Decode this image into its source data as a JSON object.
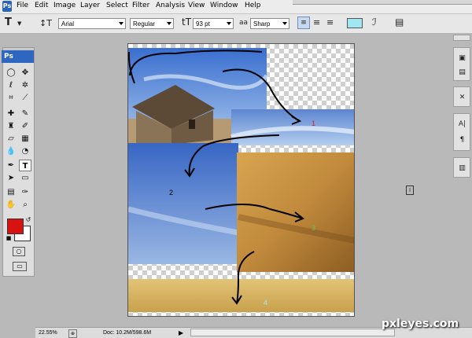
{
  "menubar": {
    "items": [
      "File",
      "Edit",
      "Image",
      "Layer",
      "Select",
      "Filter",
      "Analysis",
      "View",
      "Window",
      "Help"
    ]
  },
  "options": {
    "font_family": "Arial",
    "font_style": "Regular",
    "font_size": "93 pt",
    "anti_alias": "Sharp",
    "text_color": "#9fe8f2"
  },
  "toolbox": {
    "badge": "Ps",
    "foreground_color": "#d81111",
    "background_color": "#ffffff"
  },
  "canvas": {
    "labels": {
      "n1": "1",
      "n2": "2",
      "n3": "3",
      "n4": "4"
    }
  },
  "status": {
    "zoom": "22.55%",
    "doc_info": "Doc: 10.2M/598.6M"
  },
  "watermark": "pxleyes.com",
  "cursor_glyph": "I"
}
